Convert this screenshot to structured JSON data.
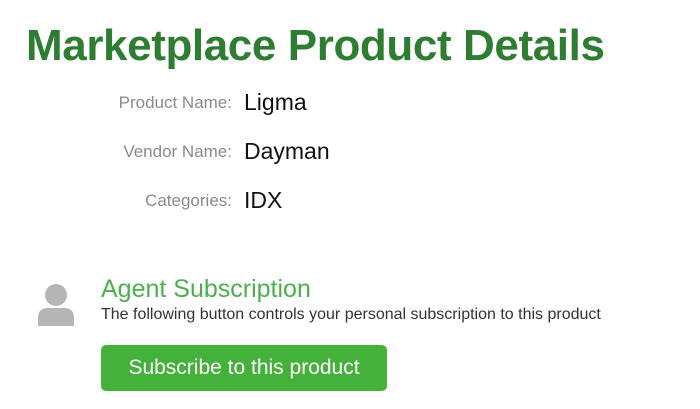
{
  "page": {
    "title": "Marketplace Product Details"
  },
  "details": {
    "product_name_label": "Product Name:",
    "product_name_value": "Ligma",
    "vendor_name_label": "Vendor Name:",
    "vendor_name_value": "Dayman",
    "categories_label": "Categories:",
    "categories_value": "IDX"
  },
  "subscription": {
    "icon": "user-avatar-icon",
    "title": "Agent Subscription",
    "description": "The following button controls your personal subscription to this product",
    "button_label": "Subscribe to this product"
  },
  "colors": {
    "title_green": "#2e7d32",
    "subtitle_green": "#4caf50",
    "button_green": "#44b23a",
    "label_gray": "#8a8a8a",
    "avatar_gray": "#b5b5b5"
  }
}
